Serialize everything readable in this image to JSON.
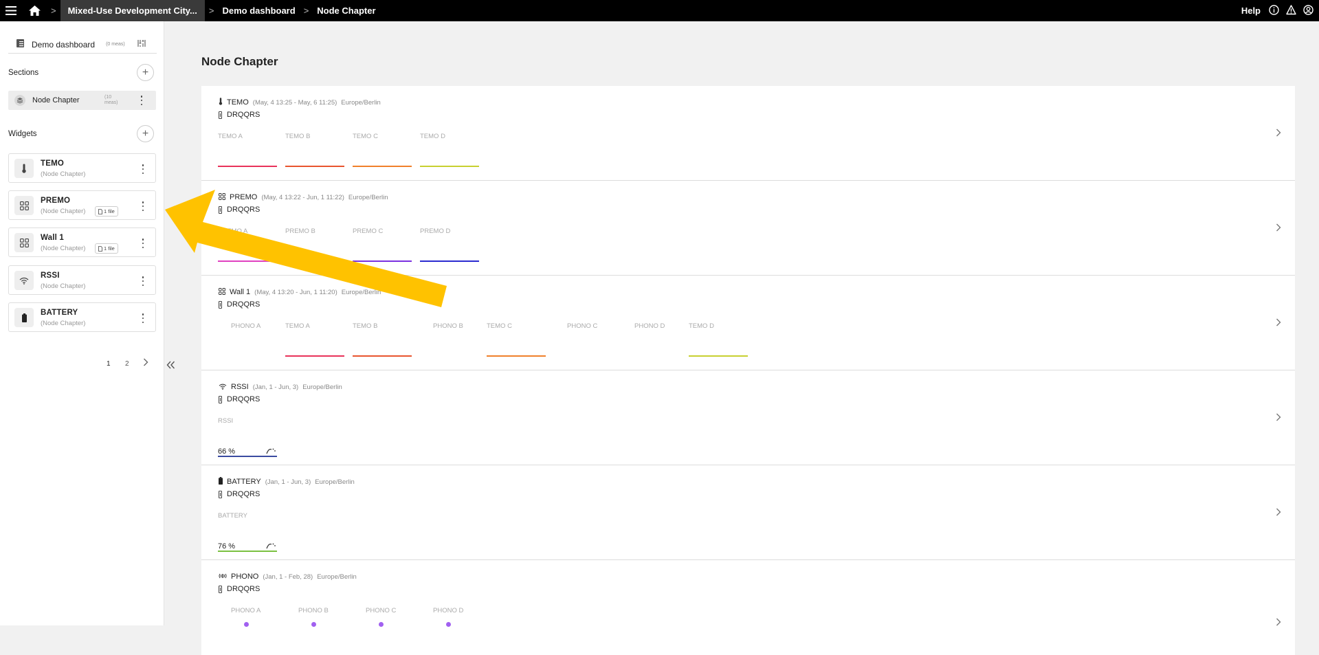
{
  "topbar": {
    "breadcrumbs": [
      "Mixed-Use Development City...",
      "Demo dashboard",
      "Node Chapter"
    ],
    "help_label": "Help"
  },
  "sidebar": {
    "dashboard_title": "Demo dashboard",
    "dashboard_meta": "(0 meas)",
    "sections_label": "Sections",
    "section_item": {
      "label": "Node Chapter",
      "meta": "(10 meas)"
    },
    "widgets_label": "Widgets",
    "widgets": [
      {
        "name": "TEMO",
        "sub": "(Node Chapter)",
        "icon": "thermometer-icon",
        "badge": ""
      },
      {
        "name": "PREMO",
        "sub": "(Node Chapter)",
        "icon": "grid-icon",
        "badge": "1 file"
      },
      {
        "name": "Wall 1",
        "sub": "(Node Chapter)",
        "icon": "grid-icon",
        "badge": "1 file"
      },
      {
        "name": "RSSI",
        "sub": "(Node Chapter)",
        "icon": "wifi-icon",
        "badge": ""
      },
      {
        "name": "BATTERY",
        "sub": "(Node Chapter)",
        "icon": "battery-icon",
        "badge": ""
      }
    ],
    "pager": {
      "pages": [
        "1",
        "2"
      ],
      "current": "1"
    }
  },
  "main": {
    "title": "Node Chapter",
    "device": "DRQQRS",
    "panels": [
      {
        "name": "TEMO",
        "range": "(May, 4 13:25 - May, 6 11:25)",
        "tz": "Europe/Berlin",
        "icon": "thermometer-icon",
        "channels": [
          {
            "label": "TEMO A",
            "color": "#e8325a"
          },
          {
            "label": "TEMO B",
            "color": "#e8542e"
          },
          {
            "label": "TEMO C",
            "color": "#f0802a"
          },
          {
            "label": "TEMO D",
            "color": "#c8d030"
          }
        ]
      },
      {
        "name": "PREMO",
        "range": "(May, 4 13:22 - Jun, 1 11:22)",
        "tz": "Europe/Berlin",
        "icon": "grid-icon",
        "channels": [
          {
            "label": "PREMO A",
            "color": "#e040c0"
          },
          {
            "label": "PREMO B",
            "color": "#b030d8"
          },
          {
            "label": "PREMO C",
            "color": "#7a30e0"
          },
          {
            "label": "PREMO D",
            "color": "#2a2ad0"
          }
        ]
      },
      {
        "name": "Wall 1",
        "range": "(May, 4 13:20 - Jun, 1 11:20)",
        "tz": "Europe/Berlin",
        "icon": "grid-icon",
        "channels": [
          {
            "label": "PHONO A",
            "color": ""
          },
          {
            "label": "TEMO A",
            "color": "#e8325a"
          },
          {
            "label": "TEMO B",
            "color": "#e8542e"
          },
          {
            "label": "PHONO B",
            "color": ""
          },
          {
            "label": "TEMO C",
            "color": "#f0802a"
          },
          {
            "label": "PHONO C",
            "color": ""
          },
          {
            "label": "PHONO D",
            "color": ""
          },
          {
            "label": "TEMO D",
            "color": "#c8d030"
          }
        ]
      },
      {
        "name": "RSSI",
        "range": "(Jan, 1 - Jun, 3)",
        "tz": "Europe/Berlin",
        "icon": "wifi-icon",
        "channel_label": "RSSI",
        "value": "66 %",
        "color": "#3a4aa0"
      },
      {
        "name": "BATTERY",
        "range": "(Jan, 1 - Jun, 3)",
        "tz": "Europe/Berlin",
        "icon": "battery-icon",
        "channel_label": "BATTERY",
        "value": "76 %",
        "color": "#7ac040"
      },
      {
        "name": "PHONO",
        "range": "(Jan, 1 - Feb, 28)",
        "tz": "Europe/Berlin",
        "icon": "sound-icon",
        "channels": [
          {
            "label": "PHONO A"
          },
          {
            "label": "PHONO B"
          },
          {
            "label": "PHONO C"
          },
          {
            "label": "PHONO D"
          }
        ]
      }
    ]
  },
  "colors": {
    "accent_arrow": "#ffc200",
    "phono_dot": "#a160f0"
  }
}
